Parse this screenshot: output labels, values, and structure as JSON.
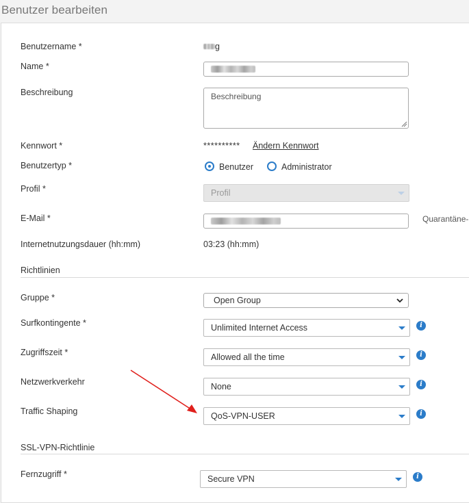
{
  "page": {
    "title": "Benutzer bearbeiten"
  },
  "fields": {
    "username": {
      "label": "Benutzername *",
      "value_suffix": "g"
    },
    "name": {
      "label": "Name *"
    },
    "description": {
      "label": "Beschreibung",
      "placeholder": "Beschreibung"
    },
    "password": {
      "label": "Kennwort *",
      "masked": "**********",
      "change_link": "Ändern Kennwort"
    },
    "user_type": {
      "label": "Benutzertyp *",
      "options": [
        "Benutzer",
        "Administrator"
      ],
      "selected": "Benutzer"
    },
    "profile": {
      "label": "Profil *",
      "value": "Profil"
    },
    "email": {
      "label": "E-Mail *",
      "quarantine_text": "Quarantäne-"
    },
    "internet_duration": {
      "label": "Internetnutzungsdauer (hh:mm)",
      "value": "03:23 (hh:mm)"
    }
  },
  "sections": {
    "policies": "Richtlinien",
    "ssl_vpn": "SSL-VPN-Richtlinie"
  },
  "policies": {
    "group": {
      "label": "Gruppe *",
      "value": "Open Group"
    },
    "surf_quota": {
      "label": "Surfkontingente *",
      "value": "Unlimited Internet Access"
    },
    "access_time": {
      "label": "Zugriffszeit *",
      "value": "Allowed all the time"
    },
    "network_traffic": {
      "label": "Netzwerkverkehr",
      "value": "None"
    },
    "traffic_shaping": {
      "label": "Traffic Shaping",
      "value": "QoS-VPN-USER"
    }
  },
  "ssl_vpn": {
    "remote_access": {
      "label": "Fernzugriff *",
      "value": "Secure VPN"
    }
  },
  "icons": {
    "info": "info-icon",
    "caret": "caret-down-icon",
    "chevron": "chevron-down-icon",
    "arrow": "annotation-arrow"
  },
  "colors": {
    "accent": "#2b7cc9",
    "arrow": "#e0201c"
  }
}
